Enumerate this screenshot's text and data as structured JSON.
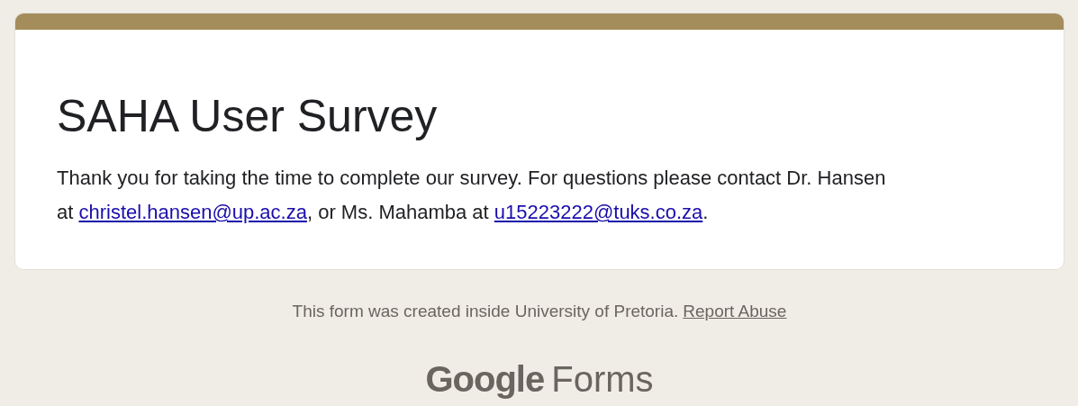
{
  "form": {
    "title": "SAHA User Survey",
    "description": [
      {
        "kind": "text",
        "text": "Thank you for taking the time to complete our survey. For questions please contact Dr. Hansen at "
      },
      {
        "kind": "link",
        "text": "christel.hansen@up.ac.za"
      },
      {
        "kind": "text",
        "text": ", or Ms. Mahamba at "
      },
      {
        "kind": "link",
        "text": "u15223222@tuks.co.za"
      },
      {
        "kind": "text",
        "text": "."
      }
    ]
  },
  "footer": {
    "notice": "This form was created inside University of Pretoria.",
    "report_link": "Report Abuse",
    "logo_brand": "Google",
    "logo_product": "Forms"
  }
}
